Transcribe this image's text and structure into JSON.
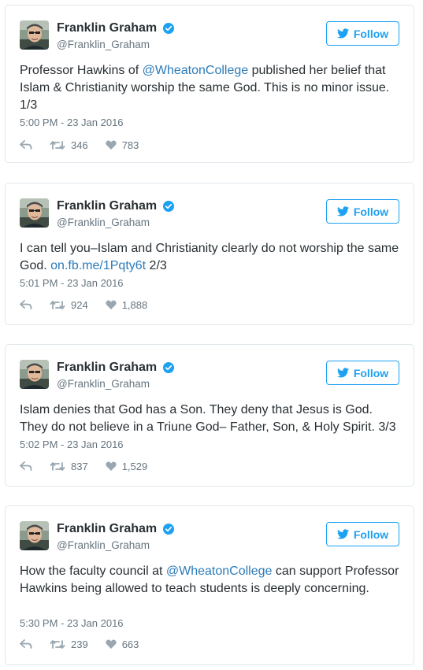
{
  "brand_color": "#1da1f2",
  "link_color": "#2b7bb9",
  "tweets": [
    {
      "author": "Franklin Graham",
      "handle": "@Franklin_Graham",
      "follow_label": "Follow",
      "text_before": "Professor Hawkins of ",
      "mention": "@WheatonCollege",
      "text_after": " published her belief that Islam & Christianity worship the same God. This is no minor issue. 1/3",
      "timestamp": "5:00 PM - 23 Jan 2016",
      "retweets": "346",
      "likes": "783"
    },
    {
      "author": "Franklin Graham",
      "handle": "@Franklin_Graham",
      "follow_label": "Follow",
      "text_before": "I can tell you–Islam and Christianity clearly do not worship the same God. ",
      "link": "on.fb.me/1Pqty6t",
      "text_after": " 2/3",
      "timestamp": "5:01 PM - 23 Jan 2016",
      "retweets": "924",
      "likes": "1,888"
    },
    {
      "author": "Franklin Graham",
      "handle": "@Franklin_Graham",
      "follow_label": "Follow",
      "text": "Islam denies that God has a Son. They deny that Jesus is God. They do not believe in a Triune God– Father, Son, & Holy Spirit. 3/3",
      "timestamp": "5:02 PM - 23 Jan 2016",
      "retweets": "837",
      "likes": "1,529"
    },
    {
      "author": "Franklin Graham",
      "handle": "@Franklin_Graham",
      "follow_label": "Follow",
      "text_before": "How the faculty council at ",
      "mention": "@WheatonCollege",
      "text_after": " can support Professor Hawkins being allowed to teach students is deeply concerning.",
      "timestamp": "5:30 PM - 23 Jan 2016",
      "retweets": "239",
      "likes": "663"
    }
  ]
}
